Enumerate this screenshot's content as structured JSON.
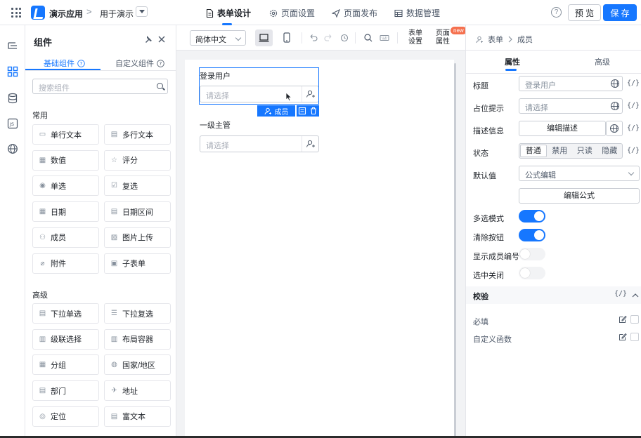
{
  "header": {
    "app_name": "演示应用",
    "breadcrumb_sep": ">",
    "app_sub": "用于演示",
    "nav": [
      {
        "label": "表单设计",
        "icon": "file-icon"
      },
      {
        "label": "页面设置",
        "icon": "gear-icon"
      },
      {
        "label": "页面发布",
        "icon": "send-icon"
      },
      {
        "label": "数据管理",
        "icon": "table-icon"
      }
    ],
    "help": "?",
    "preview_label": "预 览",
    "save_label": "保 存"
  },
  "left_panel": {
    "title": "组件",
    "tabs": [
      {
        "label": "基础组件"
      },
      {
        "label": "自定义组件"
      }
    ],
    "search_placeholder": "搜索组件",
    "sections": [
      {
        "label": "常用",
        "items": [
          {
            "label": "单行文本",
            "icon": "input-icon"
          },
          {
            "label": "多行文本",
            "icon": "textarea-icon"
          },
          {
            "label": "数值",
            "icon": "number-icon"
          },
          {
            "label": "评分",
            "icon": "star-icon"
          },
          {
            "label": "单选",
            "icon": "radio-icon"
          },
          {
            "label": "复选",
            "icon": "checkbox-icon"
          },
          {
            "label": "日期",
            "icon": "calendar-icon"
          },
          {
            "label": "日期区间",
            "icon": "calendar-range-icon"
          },
          {
            "label": "成员",
            "icon": "user-icon"
          },
          {
            "label": "图片上传",
            "icon": "image-icon"
          },
          {
            "label": "附件",
            "icon": "paperclip-icon"
          },
          {
            "label": "子表单",
            "icon": "subform-icon"
          }
        ]
      },
      {
        "label": "高级",
        "items": [
          {
            "label": "下拉单选",
            "icon": "dropdown-icon"
          },
          {
            "label": "下拉复选",
            "icon": "list-check-icon"
          },
          {
            "label": "级联选择",
            "icon": "cascade-icon"
          },
          {
            "label": "布局容器",
            "icon": "layout-icon"
          },
          {
            "label": "分组",
            "icon": "group-icon"
          },
          {
            "label": "国家/地区",
            "icon": "globe-icon"
          },
          {
            "label": "部门",
            "icon": "department-icon"
          },
          {
            "label": "地址",
            "icon": "map-icon"
          },
          {
            "label": "定位",
            "icon": "location-icon"
          },
          {
            "label": "富文本",
            "icon": "richtext-icon"
          }
        ]
      }
    ]
  },
  "toolbar": {
    "language": "简体中文",
    "form_settings": [
      "表单",
      "设置"
    ],
    "page_props": [
      "页面",
      "属性"
    ],
    "new_badge": "new"
  },
  "canvas": {
    "fields": [
      {
        "label": "登录用户",
        "placeholder": "请选择"
      },
      {
        "label": "一级主管",
        "placeholder": "请选择"
      }
    ],
    "selected_tag": "成员"
  },
  "right_panel": {
    "breadcrumb": [
      "表单",
      "成员"
    ],
    "tabs": [
      {
        "label": "属性"
      },
      {
        "label": "高级"
      }
    ],
    "title_label": "标题",
    "title_value": "登录用户",
    "placeholder_label": "占位提示",
    "placeholder_value": "请选择",
    "desc_label": "描述信息",
    "desc_button": "编辑描述",
    "state_label": "状态",
    "state_options": [
      "普通",
      "禁用",
      "只读",
      "隐藏"
    ],
    "default_label": "默认值",
    "default_value": "公式编辑",
    "formula_button": "编辑公式",
    "fx": "{/}",
    "switches": [
      {
        "label": "多选模式",
        "on": true
      },
      {
        "label": "清除按钮",
        "on": true
      },
      {
        "label": "显示成员编号",
        "on": false
      },
      {
        "label": "选中关闭",
        "on": false
      }
    ],
    "validation_title": "校验",
    "validation_items": [
      "必填",
      "自定义函数"
    ]
  },
  "colors": {
    "accent": "#1677ff",
    "badge": "#f5704e"
  }
}
